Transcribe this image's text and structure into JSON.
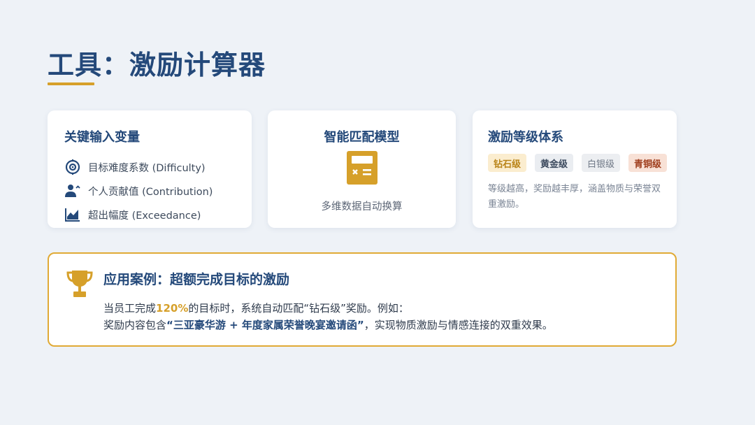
{
  "page": {
    "title": "工具：激励计算器"
  },
  "colors": {
    "navy": "#24497a",
    "gold": "#d6a02a",
    "background": "#eef2f7"
  },
  "cards": {
    "inputs": {
      "title": "关键输入变量",
      "items": [
        {
          "icon": "target-icon",
          "label": "目标难度系数 (Difficulty)"
        },
        {
          "icon": "user-chart-icon",
          "label": "个人贡献值 (Contribution)"
        },
        {
          "icon": "area-chart-icon",
          "label": "超出幅度 (Exceedance)"
        }
      ]
    },
    "model": {
      "title": "智能匹配模型",
      "icon": "calculator-icon",
      "description": "多维数据自动换算"
    },
    "tiers": {
      "title": "激励等级体系",
      "levels": [
        "钻石级",
        "黄金级",
        "白银级",
        "青铜级"
      ],
      "description": "等级越高，奖励越丰厚，涵盖物质与荣誉双重激励。"
    }
  },
  "case": {
    "icon": "trophy-icon",
    "title": "应用案例：超额完成目标的激励",
    "line1_prefix": "当员工完成",
    "line1_highlight": "120%",
    "line1_suffix": "的目标时，系统自动匹配“钻石级”奖励。例如：",
    "line2_prefix": "奖励内容包含",
    "line2_highlight": "“三亚豪华游 + 年度家属荣誉晚宴邀请函”",
    "line2_suffix": "，实现物质激励与情感连接的双重效果。"
  }
}
